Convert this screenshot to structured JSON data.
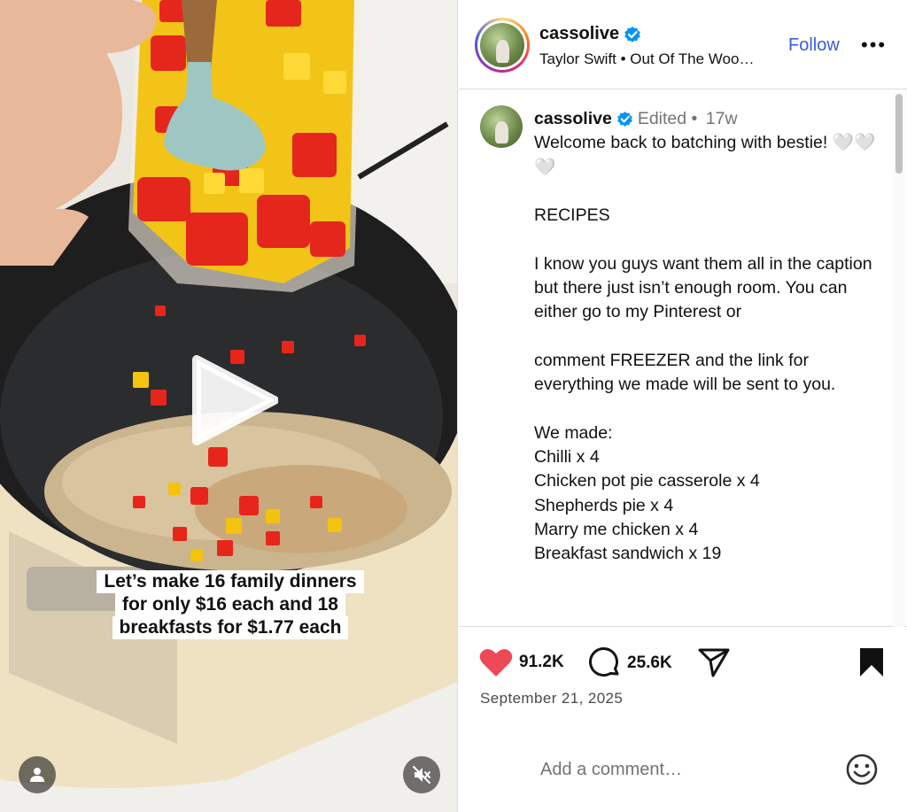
{
  "media": {
    "overlay_lines": [
      "Let’s make 16 family dinners",
      "for only $16 each and 18",
      "breakfasts for $1.77 each"
    ],
    "icons": {
      "play": "play-icon",
      "user": "user-icon",
      "mute": "muted-speaker-icon"
    }
  },
  "header": {
    "username": "cassolive",
    "audio": "Taylor Swift • Out Of The Woo…",
    "follow_label": "Follow",
    "more_label": "•••",
    "verified": true
  },
  "caption": {
    "username": "cassolive",
    "edited": "Edited",
    "sep": " • ",
    "age": "17w",
    "text": "Welcome back to batching with bestie! 🤍🤍🤍\n\nRECIPES\n\nI know you guys want them all in the caption but there just isn’t enough room. You can either go to my Pinterest or\n\ncomment FREEZER and the link for everything we made will be sent to you.\n\nWe made:\nChilli x 4\nChicken pot pie casserole x 4\nShepherds pie x 4\nMarry me chicken x 4\nBreakfast sandwich x 19"
  },
  "actions": {
    "likes": "91.2K",
    "comments": "25.6K",
    "date": "September 21, 2025",
    "like_color": "#ed4956"
  },
  "add_comment": {
    "placeholder": "Add a comment…",
    "value": ""
  },
  "colors": {
    "follow": "#3a5be0",
    "verified": "#0095f6"
  }
}
